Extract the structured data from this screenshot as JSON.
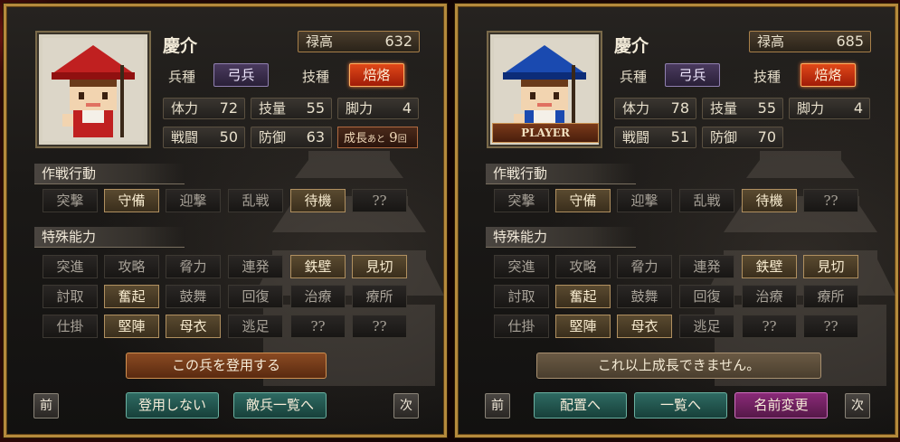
{
  "panels": [
    {
      "name": "慶介",
      "salary_label": "禄高",
      "salary": "632",
      "type_label": "兵種",
      "type_value": "弓兵",
      "skill_label": "技種",
      "skill_value": "焙烙",
      "stats": {
        "hp_label": "体力",
        "hp": "72",
        "tech_label": "技量",
        "tech": "55",
        "leg_label": "脚力",
        "leg": "4",
        "atk_label": "戦闘",
        "atk": "50",
        "def_label": "防御",
        "def": "63"
      },
      "growth": {
        "label": "成長",
        "small": "あと",
        "count": "9",
        "unit": "回"
      },
      "tactics_title": "作戦行動",
      "tactics": [
        {
          "label": "突撃",
          "on": false
        },
        {
          "label": "守備",
          "on": true
        },
        {
          "label": "迎撃",
          "on": false
        },
        {
          "label": "乱戦",
          "on": false
        },
        {
          "label": "待機",
          "on": true
        },
        {
          "label": "??",
          "on": false
        }
      ],
      "abilities_title": "特殊能力",
      "abilities": [
        {
          "label": "突進",
          "on": false
        },
        {
          "label": "攻略",
          "on": false
        },
        {
          "label": "脅力",
          "on": false
        },
        {
          "label": "連発",
          "on": false
        },
        {
          "label": "鉄壁",
          "on": true
        },
        {
          "label": "見切",
          "on": true
        },
        {
          "label": "討取",
          "on": false
        },
        {
          "label": "奮起",
          "on": true
        },
        {
          "label": "鼓舞",
          "on": false
        },
        {
          "label": "回復",
          "on": false
        },
        {
          "label": "治療",
          "on": false
        },
        {
          "label": "療所",
          "on": false
        },
        {
          "label": "仕掛",
          "on": false
        },
        {
          "label": "堅陣",
          "on": true
        },
        {
          "label": "母衣",
          "on": true
        },
        {
          "label": "逃足",
          "on": false
        },
        {
          "label": "??",
          "on": false
        },
        {
          "label": "??",
          "on": false
        }
      ],
      "main_action": "この兵を登用する",
      "prev": "前",
      "next": "次",
      "buttons": [
        "登用しない",
        "敵兵一覧へ"
      ]
    },
    {
      "name": "慶介",
      "player_tag": "PLAYER",
      "salary_label": "禄高",
      "salary": "685",
      "type_label": "兵種",
      "type_value": "弓兵",
      "skill_label": "技種",
      "skill_value": "焙烙",
      "stats": {
        "hp_label": "体力",
        "hp": "78",
        "tech_label": "技量",
        "tech": "55",
        "leg_label": "脚力",
        "leg": "4",
        "atk_label": "戦闘",
        "atk": "51",
        "def_label": "防御",
        "def": "70"
      },
      "tactics_title": "作戦行動",
      "tactics": [
        {
          "label": "突撃",
          "on": false
        },
        {
          "label": "守備",
          "on": true
        },
        {
          "label": "迎撃",
          "on": false
        },
        {
          "label": "乱戦",
          "on": false
        },
        {
          "label": "待機",
          "on": true
        },
        {
          "label": "??",
          "on": false
        }
      ],
      "abilities_title": "特殊能力",
      "abilities": [
        {
          "label": "突進",
          "on": false
        },
        {
          "label": "攻略",
          "on": false
        },
        {
          "label": "脅力",
          "on": false
        },
        {
          "label": "連発",
          "on": false
        },
        {
          "label": "鉄壁",
          "on": true
        },
        {
          "label": "見切",
          "on": true
        },
        {
          "label": "討取",
          "on": false
        },
        {
          "label": "奮起",
          "on": true
        },
        {
          "label": "鼓舞",
          "on": false
        },
        {
          "label": "回復",
          "on": false
        },
        {
          "label": "治療",
          "on": false
        },
        {
          "label": "療所",
          "on": false
        },
        {
          "label": "仕掛",
          "on": false
        },
        {
          "label": "堅陣",
          "on": true
        },
        {
          "label": "母衣",
          "on": true
        },
        {
          "label": "逃足",
          "on": false
        },
        {
          "label": "??",
          "on": false
        },
        {
          "label": "??",
          "on": false
        }
      ],
      "main_action": "これ以上成長できません。",
      "prev": "前",
      "next": "次",
      "buttons": [
        "配置へ",
        "一覧へ",
        "名前変更"
      ]
    }
  ],
  "colors": {
    "hat_left": "#c02020",
    "hat_right": "#1a4ab0",
    "accent_gold": "#b58a3c"
  }
}
